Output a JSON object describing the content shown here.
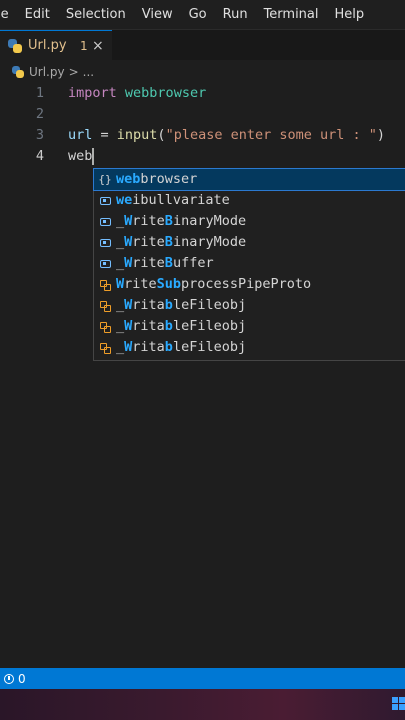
{
  "menubar": {
    "items": [
      "le",
      "Edit",
      "Selection",
      "View",
      "Go",
      "Run",
      "Terminal",
      "Help"
    ]
  },
  "tab": {
    "filename": "Url.py",
    "problem_count": "1",
    "close_glyph": "×"
  },
  "breadcrumb": {
    "file": "Url.py",
    "separator": ">",
    "more": "..."
  },
  "editor": {
    "lines": [
      {
        "number": "1",
        "tokens": [
          {
            "t": "import",
            "c": "kw"
          },
          {
            "t": " ",
            "c": ""
          },
          {
            "t": "webbrowser",
            "c": "mod"
          }
        ]
      },
      {
        "number": "2",
        "tokens": []
      },
      {
        "number": "3",
        "tokens": [
          {
            "t": "url",
            "c": "var"
          },
          {
            "t": " = ",
            "c": ""
          },
          {
            "t": "input",
            "c": "fn"
          },
          {
            "t": "(",
            "c": ""
          },
          {
            "t": "\"please enter some url : \"",
            "c": "str"
          },
          {
            "t": ")",
            "c": ""
          }
        ]
      },
      {
        "number": "4",
        "tokens": [
          {
            "t": "web",
            "c": ""
          }
        ]
      }
    ]
  },
  "suggestions": [
    {
      "kind": "module",
      "match": "web",
      "rest": "browser",
      "pre": ""
    },
    {
      "kind": "variable",
      "match": "we",
      "rest": "ibullvariate",
      "pre": ""
    },
    {
      "kind": "variable",
      "pre": "_",
      "match": "W",
      "mid": "rite",
      "match2": "B",
      "rest": "inaryMode"
    },
    {
      "kind": "variable",
      "pre": "_",
      "match": "W",
      "mid": "rite",
      "match2": "B",
      "rest": "inaryMode"
    },
    {
      "kind": "variable",
      "pre": "_",
      "match": "W",
      "mid": "rite",
      "match2": "B",
      "rest": "uffer"
    },
    {
      "kind": "class",
      "pre": "",
      "match": "W",
      "mid": "rite",
      "match2": "Sub",
      "rest": "processPipeProto"
    },
    {
      "kind": "class",
      "pre": "_",
      "match": "W",
      "mid": "rita",
      "match2": "b",
      "rest": "leFileobj"
    },
    {
      "kind": "class",
      "pre": "_",
      "match": "W",
      "mid": "rita",
      "match2": "b",
      "rest": "leFileobj"
    },
    {
      "kind": "class",
      "pre": "_",
      "match": "W",
      "mid": "rita",
      "match2": "b",
      "rest": "leFileobj"
    }
  ],
  "statusbar": {
    "problems": "0"
  },
  "colors": {
    "accent": "#0078d4",
    "editor_bg": "#1e1e1e",
    "match_highlight": "#2aaaff"
  }
}
